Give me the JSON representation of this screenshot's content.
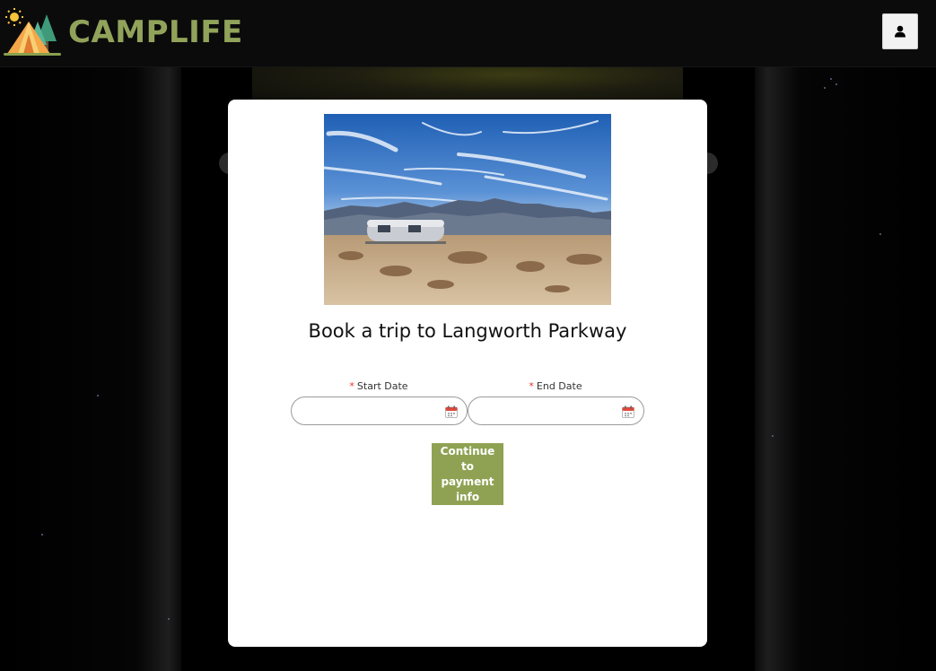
{
  "header": {
    "brand": "CAMPLIFE",
    "logo_icon": "tent-trees-sun-icon",
    "user_icon": "user-icon"
  },
  "modal": {
    "title": "Book a trip to Langworth Parkway",
    "image": "desert-trailer-photo",
    "start_date": {
      "label": "Start Date",
      "required_mark": "*",
      "value": "",
      "placeholder": ""
    },
    "end_date": {
      "label": "End Date",
      "required_mark": "*",
      "value": "",
      "placeholder": ""
    },
    "calendar_icon": "calendar-icon",
    "continue_label": "Continue to payment info"
  },
  "colors": {
    "brand": "#91a35a",
    "button": "#8fa253",
    "required": "#e4312b"
  }
}
